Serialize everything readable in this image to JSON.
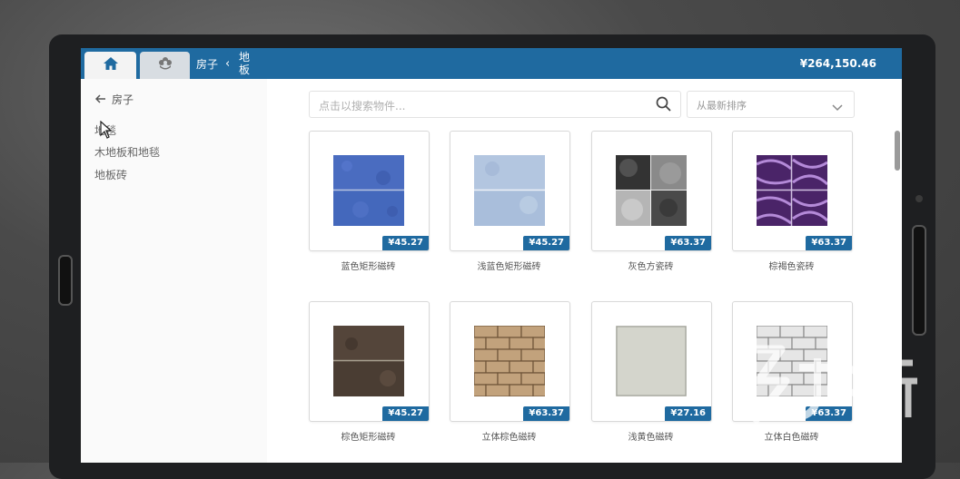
{
  "header": {
    "breadcrumb": {
      "parent": "房子",
      "separator": "‹",
      "current": "地板"
    },
    "balance": "¥264,150.46",
    "tabs": [
      {
        "name": "home",
        "icon": "home-icon"
      },
      {
        "name": "store",
        "icon": "flower-icon"
      }
    ]
  },
  "sidebar": {
    "back_label": "房子",
    "categories": [
      "地毯",
      "木地板和地毯",
      "地板砖"
    ]
  },
  "search": {
    "placeholder": "点击以搜索物件..."
  },
  "sort": {
    "value": "从最新排序"
  },
  "products": [
    {
      "name": "蓝色矩形磁砖",
      "price": "¥45.27",
      "texture": "blue-rect"
    },
    {
      "name": "浅蓝色矩形磁砖",
      "price": "¥45.27",
      "texture": "lightblue-rect"
    },
    {
      "name": "灰色方瓷砖",
      "price": "¥63.37",
      "texture": "gray-square"
    },
    {
      "name": "棕褐色瓷砖",
      "price": "¥63.37",
      "texture": "purple-square"
    },
    {
      "name": "棕色矩形磁砖",
      "price": "¥45.27",
      "texture": "brown-rect"
    },
    {
      "name": "立体棕色磁砖",
      "price": "¥63.37",
      "texture": "brick-brown"
    },
    {
      "name": "浅黄色磁砖",
      "price": "¥27.16",
      "texture": "plain-beige"
    },
    {
      "name": "立体白色磁砖",
      "price": "¥63.37",
      "texture": "brick-white"
    }
  ],
  "colors": {
    "accent": "#1f6aa0"
  }
}
